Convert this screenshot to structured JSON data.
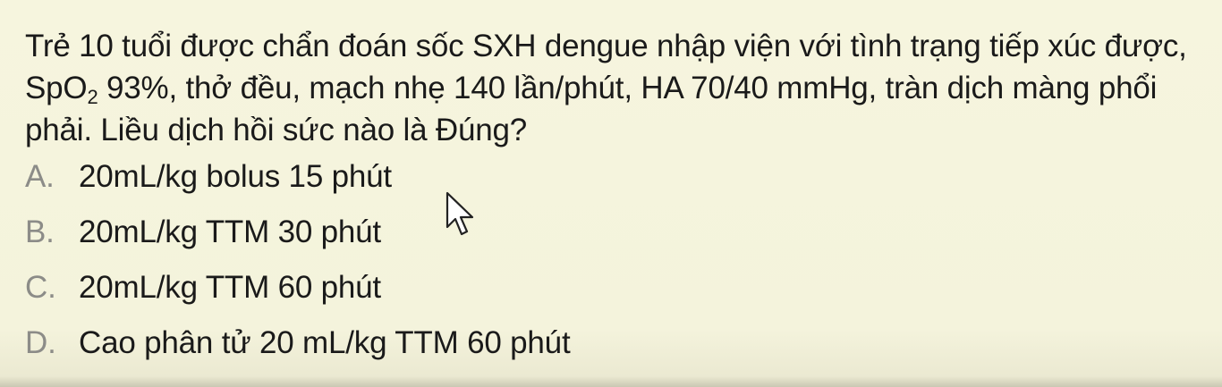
{
  "question": {
    "part1": "Trẻ 10 tuổi được chẩn đoán sốc SXH dengue nhập viện với tình trạng tiếp xúc được, SpO",
    "sub": "2",
    "part2": " 93%, thở đều, mạch nhẹ 140 lần/phút, HA 70/40 mmHg, tràn dịch màng phổi phải. Liều dịch hồi sức nào là Đúng?"
  },
  "options": [
    {
      "letter": "A.",
      "text": "20mL/kg bolus 15 phút"
    },
    {
      "letter": "B.",
      "text": "20mL/kg TTM 30 phút"
    },
    {
      "letter": "C.",
      "text": "20mL/kg TTM 60 phút"
    },
    {
      "letter": "D.",
      "text": "Cao phân tử 20 mL/kg TTM 60 phút"
    }
  ],
  "colors": {
    "background": "#f5f5dc",
    "text": "#1a1a1a",
    "option_letter": "#8c8c88"
  },
  "icons": {
    "cursor": "mouse-pointer-icon"
  }
}
